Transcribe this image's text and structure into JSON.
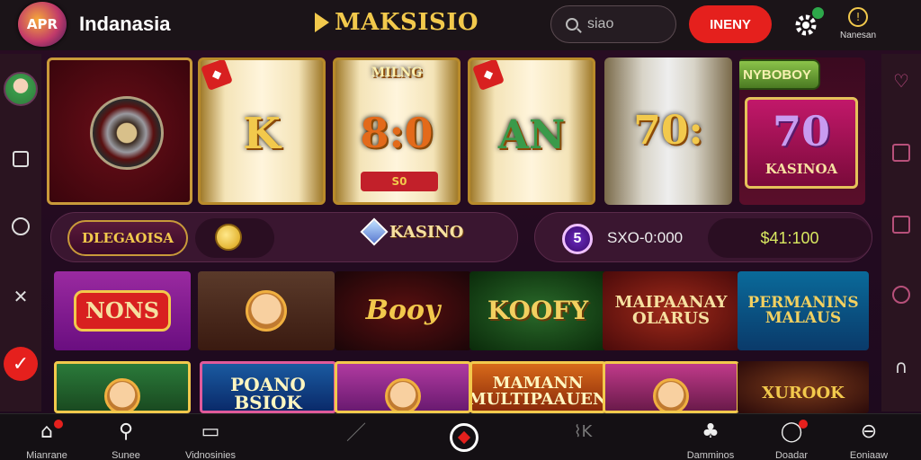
{
  "header": {
    "logo_text": "APR",
    "country": "Indanasia",
    "brand": "MAKSISIO",
    "search_placeholder": "siao",
    "menu_button": "INENY",
    "account_label": "Nanesan"
  },
  "reels": {
    "reel2": "K",
    "reel3": "8:0",
    "reel3_sub": "MILNG",
    "reel3_plate": "S0",
    "reel4": "AN",
    "reel5": "70:",
    "promo_tag": "NYBOBOY",
    "promo_num": "70",
    "promo_label": "KASINOA"
  },
  "status": {
    "banner": "DLEGAOISA",
    "kasino_label": "KASINO",
    "level": "5",
    "balance_text": "SXO-0:000",
    "balance_value": "$41:100"
  },
  "games": {
    "row1": [
      "NONS",
      "",
      "Booy",
      "KOOFY",
      "MAIPAANAY OLARUS",
      "PERMANINS MALAUS"
    ],
    "row2": [
      "",
      "POANO BSIOK",
      "",
      "MAMANN MULTIPAAUEN",
      "",
      "XUROOK"
    ]
  },
  "nav": {
    "items": [
      "Mianrane",
      "Sunee",
      "Vidnosinies",
      "",
      "",
      "",
      "Damminos",
      "Doadar",
      "Eoniaaw"
    ]
  },
  "colors": {
    "accent_red": "#e5201d",
    "gold": "#f2c94c",
    "bg": "#1c0a1e"
  }
}
